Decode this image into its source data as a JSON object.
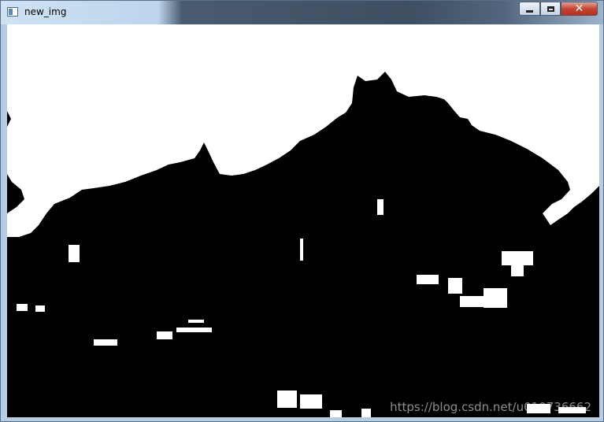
{
  "window": {
    "title": "new_img",
    "controls": {
      "minimize": "minimize",
      "maximize": "maximize",
      "close": "close"
    }
  },
  "image": {
    "description_icon": "binary-threshold-image",
    "watermark": "https://blog.csdn.net/u010736662"
  },
  "colors": {
    "foreground": "#000000",
    "background": "#ffffff",
    "title_bar": "#bcd5ec",
    "close_button": "#c64632"
  }
}
